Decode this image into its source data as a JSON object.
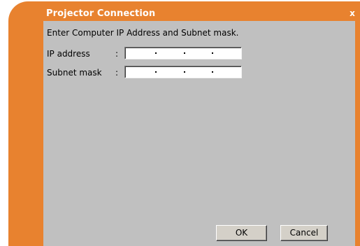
{
  "window": {
    "title": "Projector Connection",
    "close_glyph": "x"
  },
  "form": {
    "instruction": "Enter Computer IP Address and Subnet mask.",
    "fields": [
      {
        "label": "IP address",
        "separator": ":",
        "value": ". . ."
      },
      {
        "label": "Subnet mask",
        "separator": ":",
        "value": ". . ."
      }
    ]
  },
  "buttons": {
    "ok": "OK",
    "cancel": "Cancel"
  },
  "colors": {
    "frame": "#e8822f",
    "client_background": "#c0c0c0",
    "title_text": "#ffffff"
  },
  "icons": {
    "close": "close-icon"
  }
}
